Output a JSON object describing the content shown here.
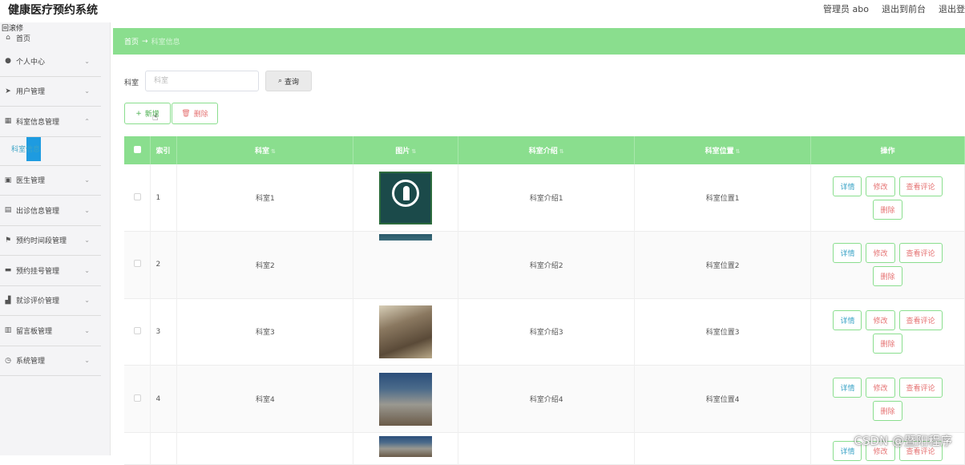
{
  "app": {
    "title": "健康医疗预约系统",
    "admin_label": "管理员 abo",
    "exit_front": "退出到前台",
    "exit": "退出登"
  },
  "sidebar": {
    "collapse_label": "回滚修",
    "home": "首页",
    "items": [
      {
        "label": "个人中心",
        "icon": "user-icon"
      },
      {
        "label": "用户管理",
        "icon": "send-icon"
      },
      {
        "label": "科室信息管理",
        "icon": "grid-icon"
      },
      {
        "label": "医生管理",
        "icon": "clipboard-icon"
      },
      {
        "label": "出诊信息管理",
        "icon": "table-icon"
      },
      {
        "label": "预约时间段管理",
        "icon": "flag-icon"
      },
      {
        "label": "预约挂号管理",
        "icon": "monitor-icon"
      },
      {
        "label": "就诊评价管理",
        "icon": "chart-icon"
      },
      {
        "label": "留言板管理",
        "icon": "board-icon"
      },
      {
        "label": "系统管理",
        "icon": "clock-icon"
      }
    ],
    "sub_item": "科室信息"
  },
  "breadcrumb": {
    "home": "首页",
    "arrow": "→",
    "current": "科室信息"
  },
  "search": {
    "label": "科室",
    "placeholder": "科室",
    "button": "查询"
  },
  "toolbar": {
    "add": "新增",
    "delete": "删除"
  },
  "table": {
    "columns": [
      "索引",
      "科室",
      "图片",
      "科室介绍",
      "科室位置",
      "操作"
    ],
    "rows": [
      {
        "index": "1",
        "dept": "科室1",
        "intro": "科室介绍1",
        "location": "科室位置1"
      },
      {
        "index": "2",
        "dept": "科室2",
        "intro": "科室介绍2",
        "location": "科室位置2"
      },
      {
        "index": "3",
        "dept": "科室3",
        "intro": "科室介绍3",
        "location": "科室位置3"
      },
      {
        "index": "4",
        "dept": "科室4",
        "intro": "科室介绍4",
        "location": "科室位置4"
      }
    ],
    "actions": {
      "detail": "详情",
      "edit": "修改",
      "review": "查看评论",
      "delete": "删除"
    }
  },
  "watermark": "CSDN @暨阳程序"
}
